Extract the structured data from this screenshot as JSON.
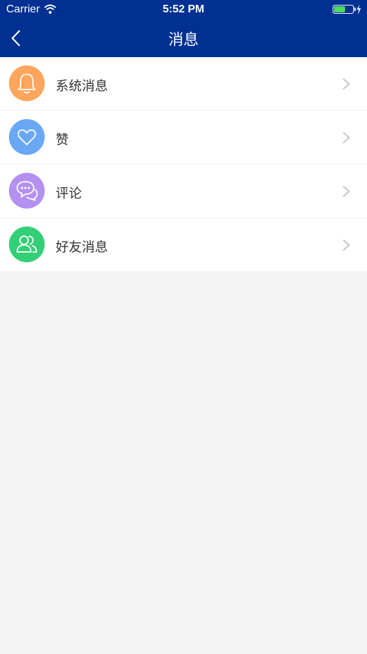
{
  "status_bar": {
    "carrier": "Carrier",
    "time": "5:52 PM"
  },
  "nav": {
    "title": "消息",
    "back_icon": "chevron-left-icon"
  },
  "colors": {
    "nav_background": "#003192",
    "icon_system": "#ffa55c",
    "icon_like": "#6aa8f5",
    "icon_comment": "#b390f2",
    "icon_friends": "#33cf77"
  },
  "list": {
    "items": [
      {
        "label": "系统消息",
        "icon": "bell-icon"
      },
      {
        "label": "赞",
        "icon": "heart-icon"
      },
      {
        "label": "评论",
        "icon": "chat-bubbles-icon"
      },
      {
        "label": "好友消息",
        "icon": "friends-icon"
      }
    ]
  }
}
